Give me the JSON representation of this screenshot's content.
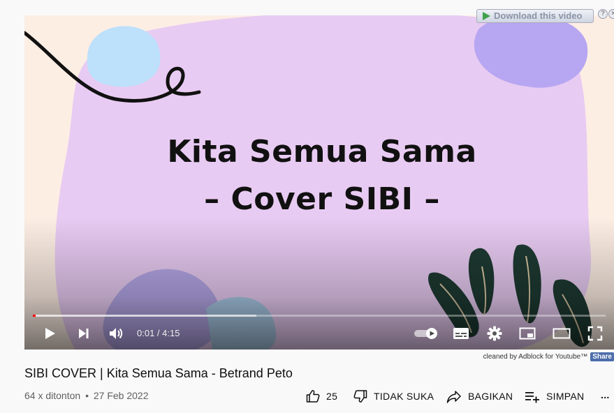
{
  "player": {
    "overlay_title_line1": "Kita Semua Sama",
    "overlay_title_line2": "– Cover SIBI –",
    "time_display": "0:01 / 4:15",
    "progress_played_fraction": 0.002,
    "progress_loaded_fraction": 0.39
  },
  "download_bar": {
    "label": "Download this video",
    "help": "?",
    "close": "×"
  },
  "adblock": {
    "text": "cleaned by Adblock for Youtube™",
    "share": "Share"
  },
  "video": {
    "title": "SIBI COVER | Kita Semua Sama - Betrand Peto",
    "views": "64 x ditonton",
    "separator": "•",
    "date": "27 Feb 2022"
  },
  "actions": {
    "like_count": "25",
    "dislike_label": "TIDAK SUKA",
    "share_label": "BAGIKAN",
    "save_label": "SIMPAN",
    "more_label": "..."
  },
  "colors": {
    "progress_played": "#ff0000",
    "background_blob": "#e5c9f0",
    "accent_purple": "#b9a6f2"
  }
}
